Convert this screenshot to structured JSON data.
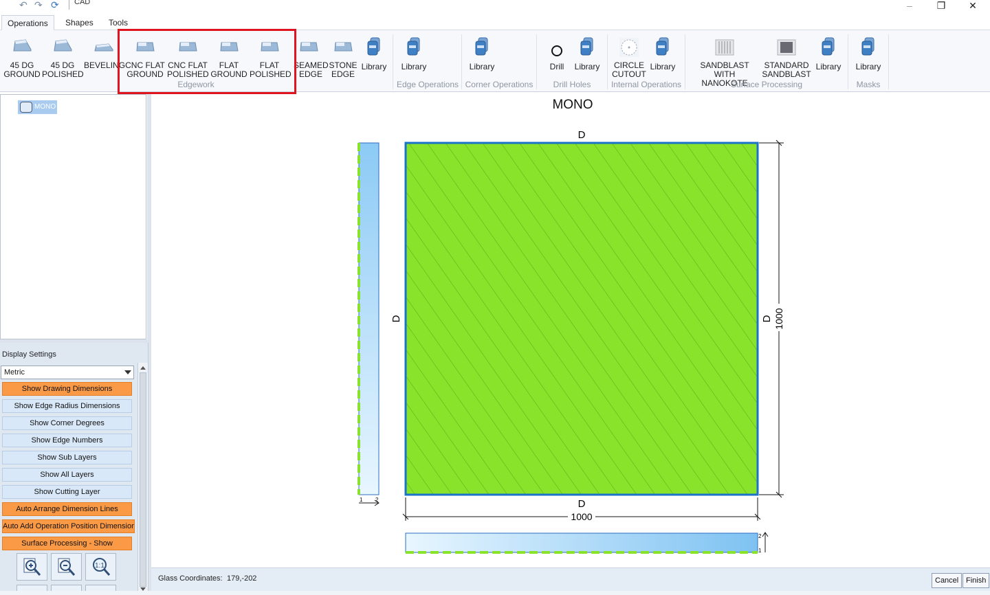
{
  "window": {
    "title": "CAD",
    "minimize_glyph": "–",
    "restore_glyph": "❐",
    "close_glyph": "✕"
  },
  "quick_access": {
    "undo_glyph": "↶",
    "redo_glyph": "↷",
    "refresh_glyph": "⟳"
  },
  "tabs": [
    "Operations",
    "Shapes",
    "Tools"
  ],
  "ribbon": {
    "edge_buttons": [
      {
        "label": "45 DG\nGROUND"
      },
      {
        "label": "45 DG\nPOLISHED"
      },
      {
        "label": "BEVELING"
      },
      {
        "label": "CNC FLAT\nGROUND"
      },
      {
        "label": "CNC FLAT\nPOLISHED"
      },
      {
        "label": "FLAT\nGROUND"
      },
      {
        "label": "FLAT\nPOLISHED"
      },
      {
        "label": "SEAMED\nEDGE"
      },
      {
        "label": "STONE\nEDGE"
      },
      {
        "label": "Library"
      }
    ],
    "edge_ops_library": "Library",
    "corner_ops_library": "Library",
    "drill": "Drill",
    "drill_library": "Library",
    "circle_cutout": "CIRCLE\nCUTOUT",
    "internal_library": "Library",
    "sandblast_nanokote": "SANDBLAST WITH\nNANOKOTE",
    "standard_sandblast": "STANDARD\nSANDBLAST",
    "surface_library": "Library",
    "masks_library": "Library",
    "groups": {
      "edgework": "Edgework",
      "edge_operations": "Edge Operations",
      "corner_operations": "Corner Operations",
      "drill_holes": "Drill Holes",
      "internal_operations": "Internal Operations",
      "surface_processing": "Surface Processing",
      "masks": "Masks"
    }
  },
  "tree": {
    "item": "MONO"
  },
  "display_settings": {
    "header": "Display Settings",
    "unit": "Metric",
    "buttons": [
      {
        "label": "Show Drawing Dimensions",
        "on": true
      },
      {
        "label": "Show Edge Radius Dimensions",
        "on": false
      },
      {
        "label": "Show Corner Degrees",
        "on": false
      },
      {
        "label": "Show Edge Numbers",
        "on": false
      },
      {
        "label": "Show Sub Layers",
        "on": false
      },
      {
        "label": "Show All Layers",
        "on": false
      },
      {
        "label": "Show Cutting Layer",
        "on": false
      },
      {
        "label": "Auto Arrange Dimension Lines",
        "on": true
      },
      {
        "label": "Auto Add Operation Position Dimension",
        "on": true
      },
      {
        "label": "Surface Processing - Show",
        "on": true
      }
    ]
  },
  "drawing": {
    "title": "MONO",
    "edge_top": "D",
    "edge_bottom": "D",
    "edge_left": "D",
    "edge_right": "D",
    "width_dim": "1000",
    "height_dim": "1000",
    "side_view_label_1": "1",
    "side_view_label_2": "2",
    "fill_color": "#88e32a",
    "outline_color": "#1a73c8"
  },
  "status": {
    "coord_label": "Glass Coordinates:",
    "coord_value": "179,-202"
  },
  "footer": {
    "cancel": "Cancel",
    "finish": "Finish"
  },
  "colors": {
    "active_toggle": "#fb9a46",
    "inactive_toggle": "#d9e8f8",
    "highlight": "#e0141e"
  }
}
